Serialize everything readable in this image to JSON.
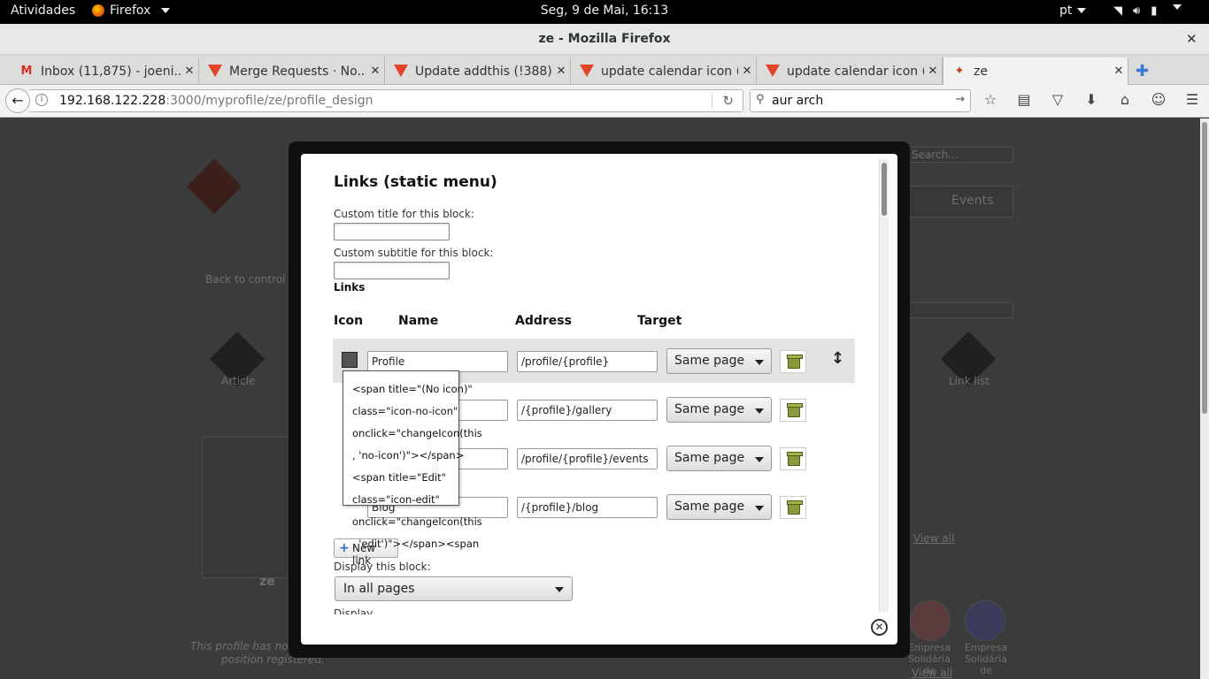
{
  "topbar": {
    "activities": "Atividades",
    "app": "Firefox",
    "clock": "Seg,  9 de Mai, 16:13",
    "language": "pt"
  },
  "window": {
    "title": "ze - Mozilla Firefox"
  },
  "tabs": [
    {
      "label": "Inbox (11,875) - joeni...",
      "icon": "gmail-icon"
    },
    {
      "label": "Merge Requests · No...",
      "icon": "gitlab-icon"
    },
    {
      "label": "Update addthis (!388) ...",
      "icon": "gitlab-icon"
    },
    {
      "label": "update calendar icon (...",
      "icon": "gitlab-icon"
    },
    {
      "label": "update calendar icon (...",
      "icon": "gitlab-icon"
    },
    {
      "label": "ze",
      "icon": "noosfero-icon",
      "active": true
    }
  ],
  "navbar": {
    "url_host": "192.168.122.228",
    "url_path": ":3000/myprofile/ze/profile_design",
    "search_value": "aur arch"
  },
  "background": {
    "search": "Search...",
    "events": "Events",
    "back": "Back to control pa...",
    "article": "Article",
    "link_list": "Link list",
    "view_all": "View all",
    "view_all_2": "View all",
    "ze": "ze",
    "no_geo": "This profile has no geographical",
    "position": "position registered.",
    "empresa1": "Empresa Solidária de",
    "empresa2": "Empresa Solidária de"
  },
  "modal": {
    "title": "Links (static menu)",
    "custom_title_label": "Custom title for this block:",
    "custom_subtitle_label": "Custom subtitle for this block:",
    "links_label": "Links",
    "columns": {
      "icon": "Icon",
      "name": "Name",
      "address": "Address",
      "target": "Target"
    },
    "rows": [
      {
        "name": "Profile",
        "address": "/profile/{profile}",
        "target": "Same page"
      },
      {
        "name": "",
        "address": "/{profile}/gallery",
        "target": "Same page"
      },
      {
        "name": "",
        "address": "/profile/{profile}/events",
        "target": "Same page"
      },
      {
        "name": "Blog",
        "address": "/{profile}/blog",
        "target": "Same page"
      }
    ],
    "new_link": "New link",
    "display_label": "Display this block:",
    "display_value": "In all pages",
    "display2_label": "Display"
  },
  "tooltip": {
    "text": "<span title=\"(No icon)\" class=\"icon-no-icon\" onclick=\"changeIcon(this, 'no-icon')\"></span><span title=\"Edit\" class=\"icon-edit\" onclick=\"changeIcon(this, 'edit')\"></span><span"
  }
}
